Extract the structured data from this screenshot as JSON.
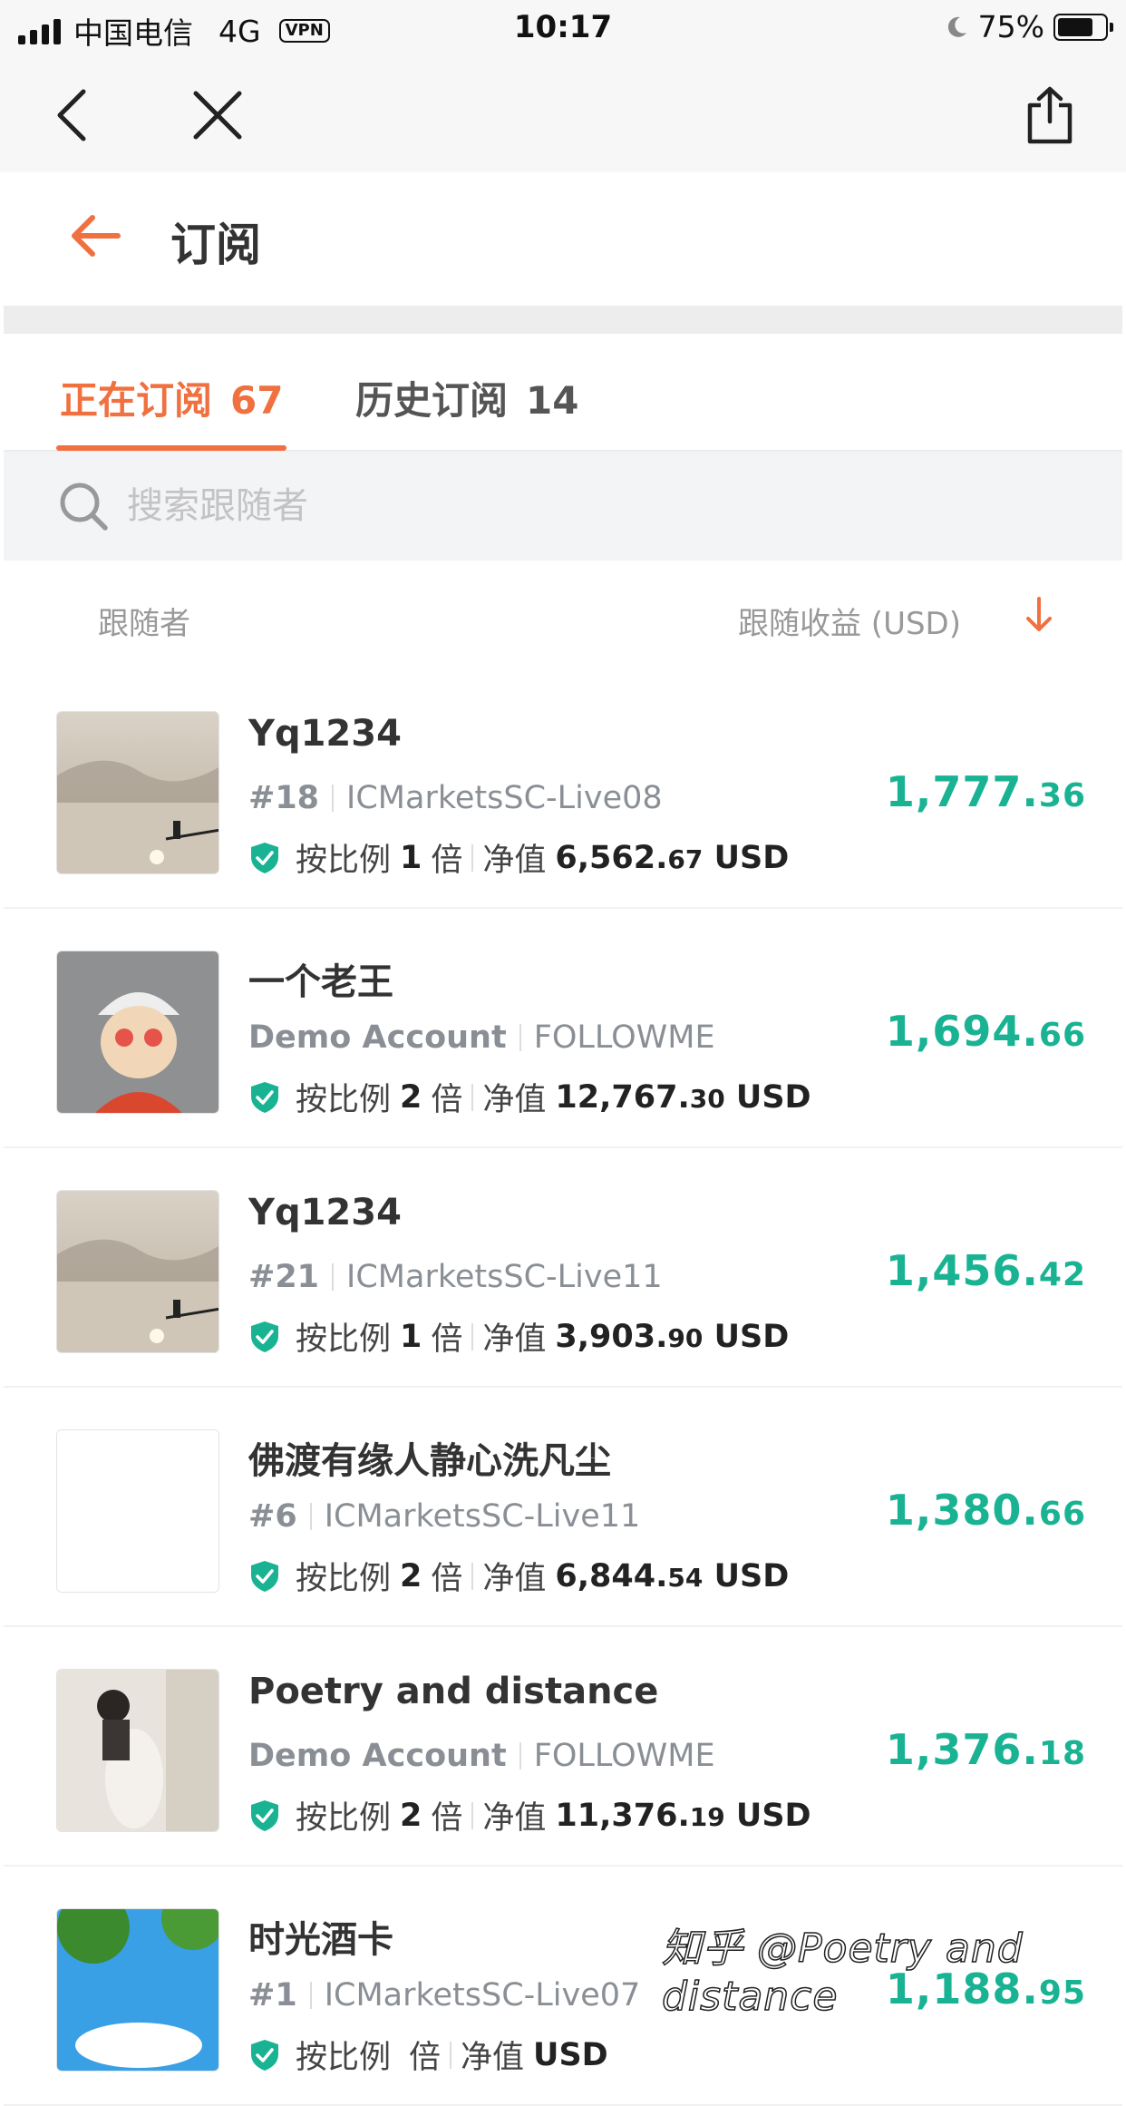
{
  "status_bar": {
    "carrier": "中国电信",
    "network": "4G",
    "vpn": "VPN",
    "time": "10:17",
    "battery_level": 0.75,
    "battery_text": "75%"
  },
  "browser": {
    "back_icon": "chevron-left-icon",
    "close_icon": "close-icon",
    "share_icon": "share-icon"
  },
  "header": {
    "title": "订阅",
    "back_icon": "arrow-left-icon",
    "accent": "#f07040"
  },
  "tabs": [
    {
      "label": "正在订阅",
      "count": "67",
      "active": true
    },
    {
      "label": "历史订阅",
      "count": "14",
      "active": false
    }
  ],
  "search": {
    "placeholder": "搜索跟随者"
  },
  "columns": {
    "follower": "跟随者",
    "profit": "跟随收益 (USD)",
    "sort_icon": "arrow-down-icon"
  },
  "followers": [
    {
      "name": "Yq1234",
      "account_id": "#18",
      "server": "ICMarketsSC-Live08",
      "ratio_prefix": "按比例",
      "ratio": "1",
      "ratio_suffix": "倍",
      "equity_label": "净值",
      "equity_int": "6,562.",
      "equity_dec": "67",
      "equity_unit": "USD",
      "profit_int": "1,777.",
      "profit_dec": "36",
      "avatar": "landscape"
    },
    {
      "name": "一个老王",
      "account_id": "Demo Account",
      "server": "FOLLOWME",
      "ratio_prefix": "按比例",
      "ratio": "2",
      "ratio_suffix": "倍",
      "equity_label": "净值",
      "equity_int": "12,767.",
      "equity_dec": "30",
      "equity_unit": "USD",
      "profit_int": "1,694.",
      "profit_dec": "66",
      "avatar": "cartoon"
    },
    {
      "name": "Yq1234",
      "account_id": "#21",
      "server": "ICMarketsSC-Live11",
      "ratio_prefix": "按比例",
      "ratio": "1",
      "ratio_suffix": "倍",
      "equity_label": "净值",
      "equity_int": "3,903.",
      "equity_dec": "90",
      "equity_unit": "USD",
      "profit_int": "1,456.",
      "profit_dec": "42",
      "avatar": "landscape"
    },
    {
      "name": "佛渡有缘人静心洗凡尘",
      "account_id": "#6",
      "server": "ICMarketsSC-Live11",
      "ratio_prefix": "按比例",
      "ratio": "2",
      "ratio_suffix": "倍",
      "equity_label": "净值",
      "equity_int": "6,844.",
      "equity_dec": "54",
      "equity_unit": "USD",
      "profit_int": "1,380.",
      "profit_dec": "66",
      "avatar": "blank"
    },
    {
      "name": "Poetry and distance",
      "account_id": "Demo Account",
      "server": "FOLLOWME",
      "ratio_prefix": "按比例",
      "ratio": "2",
      "ratio_suffix": "倍",
      "equity_label": "净值",
      "equity_int": "11,376.",
      "equity_dec": "19",
      "equity_unit": "USD",
      "profit_int": "1,376.",
      "profit_dec": "18",
      "avatar": "photo"
    },
    {
      "name": "时光酒卡",
      "account_id": "#1",
      "server": "ICMarketsSC-Live07",
      "ratio_prefix": "按比例",
      "ratio": "",
      "ratio_suffix": "倍",
      "equity_label": "净值",
      "equity_int": "",
      "equity_dec": "",
      "equity_unit": "USD",
      "profit_int": "1,188.",
      "profit_dec": "95",
      "avatar": "sky"
    }
  ],
  "colors": {
    "accent": "#f07040",
    "profit": "#19b394",
    "verified": "#19b394"
  },
  "watermark": "知乎 @Poetry and distance"
}
